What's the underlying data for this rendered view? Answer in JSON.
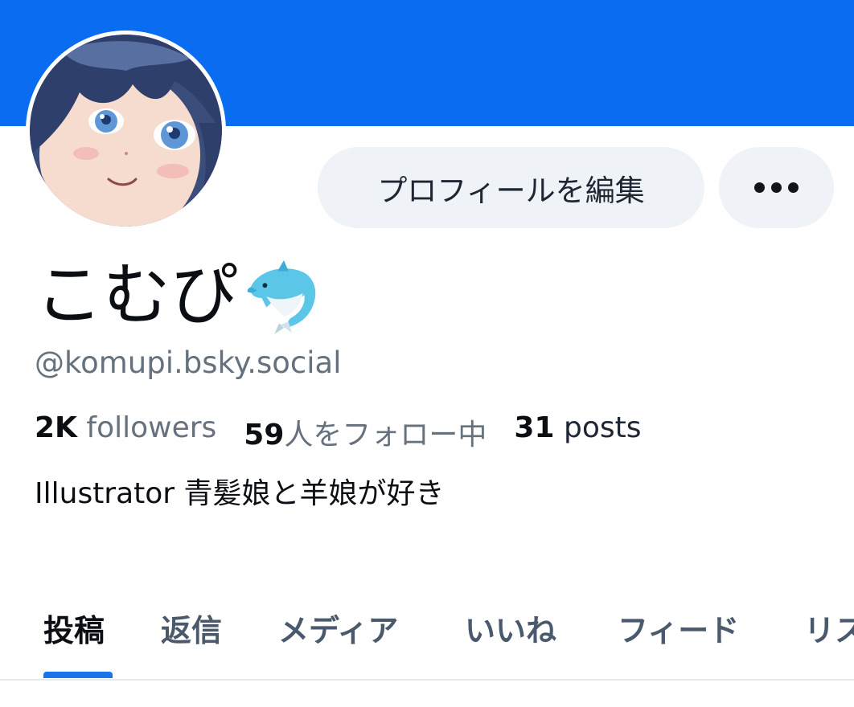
{
  "colors": {
    "banner": "#0a6cf1",
    "button_bg": "#eff2f6",
    "accent": "#1a73e8",
    "muted_text": "#66717e"
  },
  "actions": {
    "edit_profile_label": "プロフィールを編集",
    "more_icon": "ellipsis-icon"
  },
  "profile": {
    "display_name": "こむぴ",
    "name_emoji": "dolphin-emoji",
    "handle": "@komupi.bsky.social",
    "bio": "Illustrator 青髪娘と羊娘が好き"
  },
  "stats": {
    "followers_count": "2K",
    "followers_label": "followers",
    "following_count": "59",
    "following_label": "人をフォロー中",
    "posts_count": "31",
    "posts_label": "posts"
  },
  "tabs": [
    {
      "label": "投稿",
      "active": true
    },
    {
      "label": "返信",
      "active": false
    },
    {
      "label": "メディア",
      "active": false
    },
    {
      "label": "いいね",
      "active": false
    },
    {
      "label": "フィード",
      "active": false
    },
    {
      "label": "リス",
      "active": false
    }
  ]
}
